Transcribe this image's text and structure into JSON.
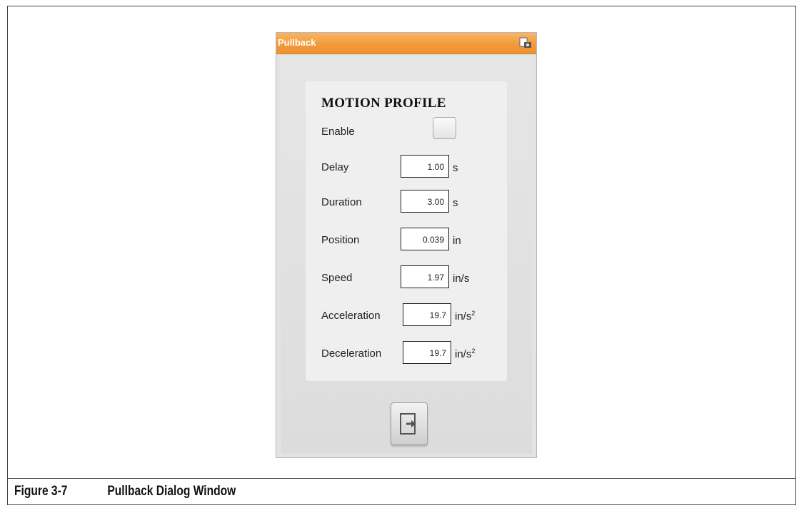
{
  "dialog": {
    "title": "Pullback",
    "panel_title": "MOTION PROFILE",
    "enable_label": "Enable",
    "enable_checked": false,
    "fields": [
      {
        "label": "Delay",
        "value": "1.00",
        "unit": "s",
        "unit_sup": ""
      },
      {
        "label": "Duration",
        "value": "3.00",
        "unit": "s",
        "unit_sup": ""
      },
      {
        "label": "Position",
        "value": "0.039",
        "unit": "in",
        "unit_sup": ""
      },
      {
        "label": "Speed",
        "value": "1.97",
        "unit": "in/s",
        "unit_sup": ""
      },
      {
        "label": "Acceleration",
        "value": "19.7",
        "unit": "in/s",
        "unit_sup": "2"
      },
      {
        "label": "Deceleration",
        "value": "19.7",
        "unit": "in/s",
        "unit_sup": "2"
      }
    ],
    "icons": {
      "snapshot": "screenshot-icon",
      "exit": "exit-icon"
    },
    "accent_color": "#f29a3a"
  },
  "caption": {
    "number": "Figure 3-7",
    "text": "Pullback Dialog Window"
  }
}
